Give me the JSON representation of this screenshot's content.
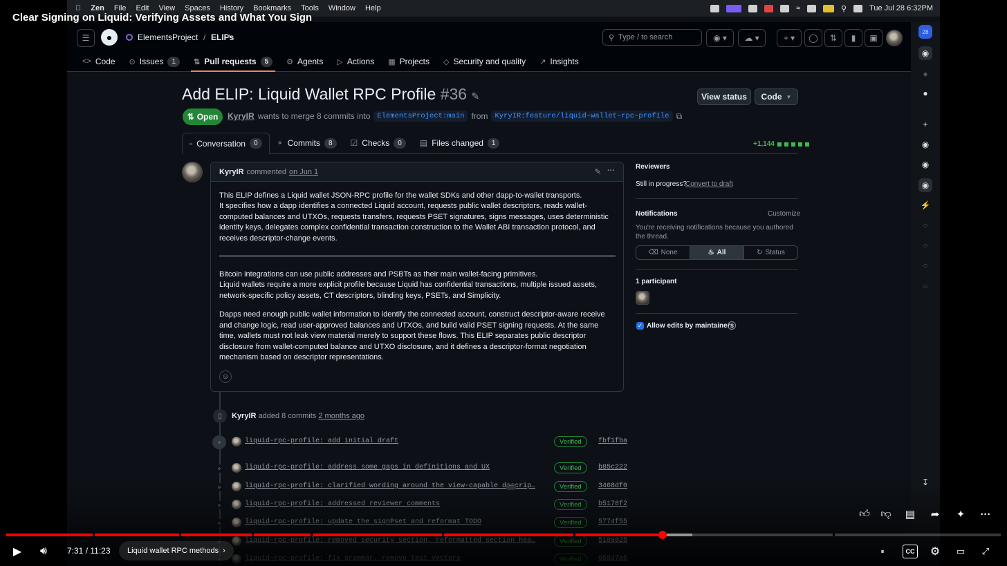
{
  "video": {
    "title": "Clear Signing on Liquid: Verifying Assets and What You Sign",
    "time": "7:31 / 11:23",
    "chapter": "Liquid wallet RPC methods",
    "played_fraction": 0.66,
    "buffered_fraction": 0.69
  },
  "menubar": {
    "app": "Zen",
    "items": [
      "File",
      "Edit",
      "View",
      "Spaces",
      "History",
      "Bookmarks",
      "Tools",
      "Window",
      "Help"
    ],
    "clock": "Tue Jul 28  6:32PM"
  },
  "github": {
    "owner": "ElementsProject",
    "repo": "ELIPs",
    "search_placeholder": "Type / to search",
    "tabs": [
      {
        "label": "Code",
        "icon": "<>",
        "count": ""
      },
      {
        "label": "Issues",
        "icon": "⊙",
        "count": "1"
      },
      {
        "label": "Pull requests",
        "icon": "⇅",
        "count": "5"
      },
      {
        "label": "Agents",
        "icon": "⚙",
        "count": ""
      },
      {
        "label": "Actions",
        "icon": "▷",
        "count": ""
      },
      {
        "label": "Projects",
        "icon": "▦",
        "count": ""
      },
      {
        "label": "Security and quality",
        "icon": "◇",
        "count": ""
      },
      {
        "label": "Insights",
        "icon": "↗",
        "count": ""
      }
    ]
  },
  "pr": {
    "title": "Add ELIP: Liquid Wallet RPC Profile",
    "number": "#36",
    "state": "Open",
    "author": "KyryIR",
    "merge_text": "wants to merge 8 commits into",
    "base_branch": "ElementsProject:main",
    "from_text": "from",
    "head_branch": "KyryIR:feature/liquid-wallet-rpc-profile",
    "view_status": "View status",
    "code_button": "Code",
    "tabs": [
      {
        "label": "Conversation",
        "count": "0"
      },
      {
        "label": "Commits",
        "count": "8"
      },
      {
        "label": "Checks",
        "count": "0"
      },
      {
        "label": "Files changed",
        "count": "1"
      }
    ],
    "diffstat": "+1,144"
  },
  "comment": {
    "author": "KyryIR",
    "action": "commented",
    "date": "on Jun 1",
    "p1": "This ELIP defines a Liquid wallet JSON-RPC profile for the wallet SDKs and other dapp-to-wallet transports.",
    "p2": "It specifies how a dapp identifies a connected Liquid account, requests public wallet descriptors, reads wallet-computed balances and UTXOs, requests transfers, requests PSET signatures, signs messages, uses deterministic identity keys, delegates complex confidential transaction construction to the Wallet ABI transaction protocol, and receives descriptor-change events.",
    "p3": "Bitcoin integrations can use public addresses and PSBTs as their main wallet-facing primitives.",
    "p4": "Liquid wallets require a more explicit profile because Liquid has confidential transactions, multiple issued assets, network-specific policy assets, CT descriptors, blinding keys, PSETs, and Simplicity.",
    "p5": "Dapps need enough public wallet information to identify the connected account, construct descriptor-aware receive and change logic, read user-approved balances and UTXOs, and build valid PSET signing requests. At the same time, wallets must not leak view material merely to support these flows. This ELIP separates public descriptor disclosure from wallet-computed balance and UTXO disclosure, and it defines a descriptor-format negotiation mechanism based on descriptor representations."
  },
  "sidebar": {
    "reviewers_title": "Reviewers",
    "in_progress": "Still in progress?",
    "convert": "Convert to draft",
    "notifications_title": "Notifications",
    "customize": "Customize",
    "notif_text": "You're receiving notifications because you authored the thread.",
    "seg": [
      "None",
      "All",
      "Status"
    ],
    "participants": "1 participant",
    "allow_edits": "Allow edits by maintainers"
  },
  "timeline": {
    "author": "KyryIR",
    "action": "added 8 commits",
    "when": "2 months ago",
    "verified_label": "Verified",
    "commits": [
      {
        "msg": "liquid-rpc-profile: add initial draft",
        "sha": "fbf1fba",
        "more": false
      },
      {
        "msg": "liquid-rpc-profile: address some gaps in definitions and UX",
        "sha": "b85c222",
        "more": false
      },
      {
        "msg": "liquid-rpc-profile: clarified wording around the view-capable descrip…",
        "sha": "3468df0",
        "more": true
      },
      {
        "msg": "liquid-rpc-profile: addressed reviewer comments",
        "sha": "b5178f2",
        "more": false
      },
      {
        "msg": "liquid-rpc-profile: update the signPset and reformat TODO",
        "sha": "5774f55",
        "more": false
      },
      {
        "msg": "liquid-rpc-profile: removed security section, reformatted section hea…",
        "sha": "510a025",
        "more": false
      },
      {
        "msg": "liquid-rpc-profile: fix grammar, remove test vectors",
        "sha": "05837a6",
        "more": false
      }
    ]
  },
  "icons": {
    "apple": "apple-icon",
    "github": "github-logo-icon",
    "search": "search-icon",
    "play": "play-icon",
    "volume": "volume-icon",
    "like": "thumbs-up-icon",
    "dislike": "thumbs-down-icon",
    "comments": "comment-icon",
    "share": "share-icon",
    "sparkle": "sparkle-icon",
    "more": "more-icon",
    "cc": "captions-icon",
    "settings": "gear-icon",
    "cast": "cast-icon",
    "fullscreen": "fullscreen-exit-icon"
  },
  "colors": {
    "accent": "#f78166",
    "open": "#238636",
    "link": "#4493f8",
    "progress": "#ff0000"
  }
}
